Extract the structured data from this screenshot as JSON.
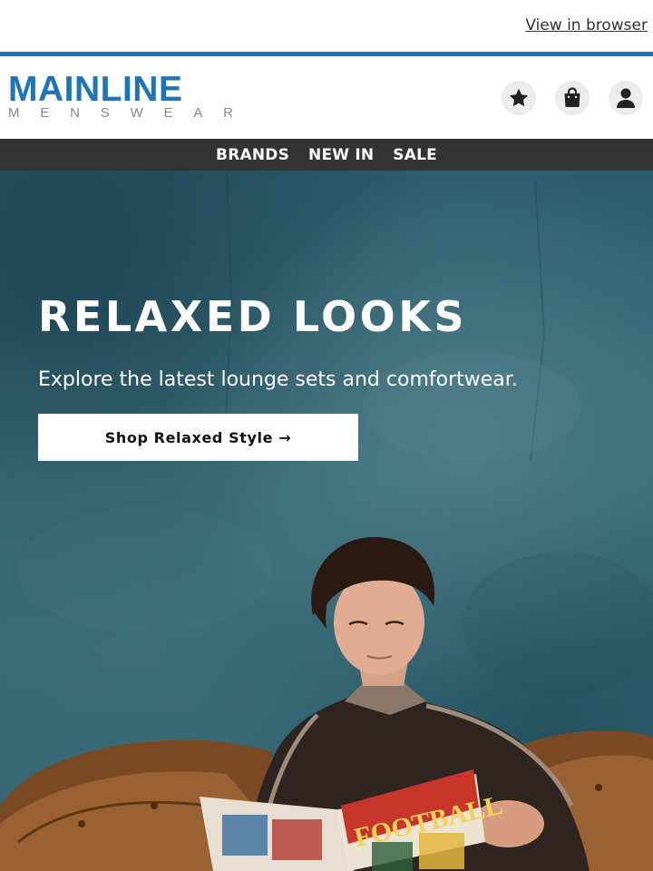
{
  "topbar": {
    "view_in_browser": "View in browser"
  },
  "brand": {
    "name": "MAINLINE",
    "tagline_letters": [
      "M",
      "E",
      "N",
      "S",
      "W",
      "E",
      "A",
      "R"
    ],
    "color": "#1f73b7"
  },
  "header_icons": [
    {
      "name": "wishlist",
      "icon": "star-icon"
    },
    {
      "name": "bag",
      "icon": "shopping-bag-icon"
    },
    {
      "name": "account",
      "icon": "user-icon"
    }
  ],
  "nav": {
    "items": [
      "BRANDS",
      "NEW IN",
      "SALE"
    ]
  },
  "hero": {
    "title": "RELAXED LOOKS",
    "subtitle": "Explore the latest lounge sets and comfortwear.",
    "cta": "Shop Relaxed Style →",
    "magazine_title": "FOOTBALL"
  },
  "colors": {
    "accent": "#1f73b7",
    "nav_bg": "#333333",
    "hero_bg": "#2f5f6d"
  }
}
